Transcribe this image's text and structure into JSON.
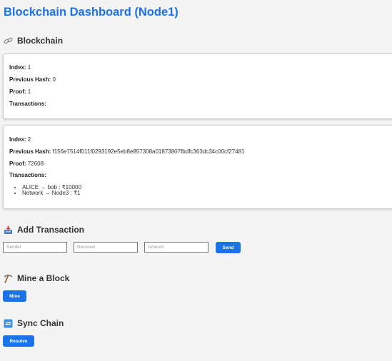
{
  "page": {
    "title": "Blockchain Dashboard (Node1)"
  },
  "sections": {
    "blockchain": "Blockchain",
    "add_transaction": "Add Transaction",
    "mine": "Mine a Block",
    "sync": "Sync Chain"
  },
  "labels": {
    "index": "Index:",
    "previous_hash": "Previous Hash:",
    "proof": "Proof:",
    "transactions": "Transactions:"
  },
  "blocks": [
    {
      "index": "1",
      "previous_hash": "0",
      "proof": "1",
      "transactions": []
    },
    {
      "index": "2",
      "previous_hash": "f156e7514f011f0293192e5eb8e857308a01873807fbdfc363dc34c00cf27481",
      "proof": "72608",
      "transactions": [
        "ALICE → bob : ₹10000",
        "Network → Node3 : ₹1"
      ]
    }
  ],
  "form": {
    "sender_placeholder": "Sender",
    "receiver_placeholder": "Receiver",
    "amount_placeholder": "Amount",
    "send_label": "Send"
  },
  "mine": {
    "button_label": "Mine"
  },
  "sync": {
    "button_label": "Resolve"
  },
  "icons": {
    "blockchain": "link-icon",
    "add_transaction": "inbox-tray-icon",
    "mine": "pickaxe-icon",
    "sync": "sync-icon"
  },
  "colors": {
    "accent": "#1a73e8",
    "background": "#f4f4f4",
    "card": "#ffffff"
  }
}
